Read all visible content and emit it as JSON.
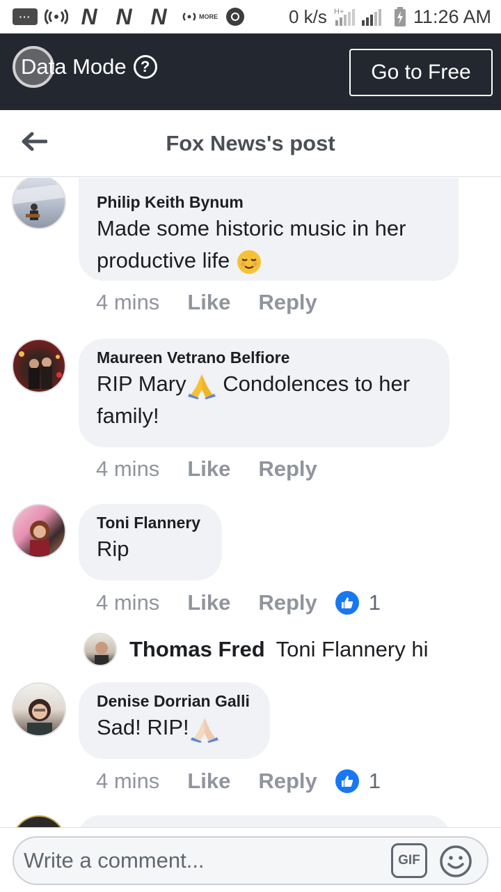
{
  "status_bar": {
    "more_label": "MORE",
    "network_speed": "0 k/s",
    "network_type": "H+",
    "time": "11:26 AM"
  },
  "data_mode": {
    "label": "Data Mode",
    "help_icon": "?",
    "go_to_free": "Go to Free"
  },
  "header": {
    "title": "Fox News's post",
    "back_icon": "arrow-left-icon"
  },
  "comments": [
    {
      "author": "Philip Keith Bynum",
      "text": "Made some historic music in her productive life",
      "emoji": "relieved-face",
      "time": "4 mins",
      "like_label": "Like",
      "reply_label": "Reply"
    },
    {
      "author": "Maureen Vetrano Belfiore",
      "text_before": "RIP Mary",
      "text_after": " Condolences to her family!",
      "emoji": "folded-hands",
      "time": "4 mins",
      "like_label": "Like",
      "reply_label": "Reply"
    },
    {
      "author": "Toni Flannery",
      "text": "Rip",
      "time": "4 mins",
      "like_label": "Like",
      "reply_label": "Reply",
      "reaction_count": "1",
      "reply": {
        "author": "Thomas Fred",
        "text": "Toni Flannery hi"
      }
    },
    {
      "author": "Denise Dorrian Galli",
      "text": "Sad! RIP!",
      "emoji": "folded-hands",
      "time": "4 mins",
      "like_label": "Like",
      "reply_label": "Reply",
      "reaction_count": "1"
    }
  ],
  "composer": {
    "placeholder": "Write a comment...",
    "gif_label": "GIF"
  },
  "colors": {
    "data_bar_bg": "#23272f",
    "bubble_bg": "#f0f2f5",
    "meta_gray": "#90949c",
    "like_blue": "#1877f2"
  }
}
